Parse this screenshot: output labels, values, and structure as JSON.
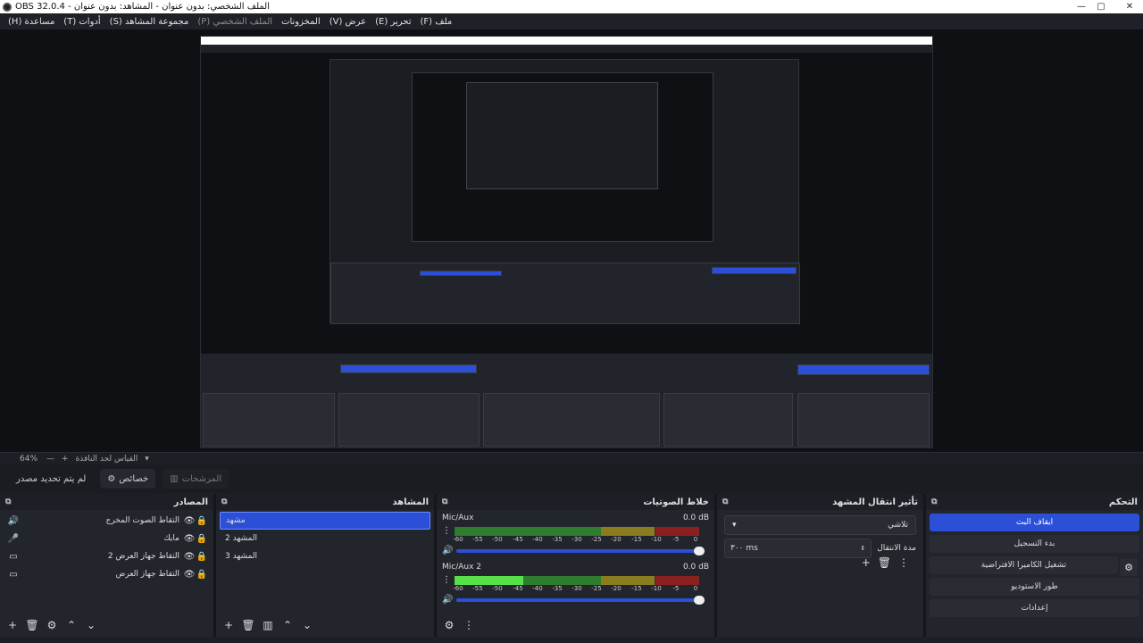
{
  "window": {
    "title": "OBS 32.0.4 - الملف الشخصي: بدون عنوان - المشاهد: بدون عنوان"
  },
  "menu": [
    {
      "label": "ملف (F)",
      "dim": false
    },
    {
      "label": "تحرير (E)",
      "dim": false
    },
    {
      "label": "عرض (V)",
      "dim": false
    },
    {
      "label": "المخزونات",
      "dim": false
    },
    {
      "label": "الملف الشخصي (P)",
      "dim": true
    },
    {
      "label": "مجموعة المشاهد (S)",
      "dim": false
    },
    {
      "label": "أدوات (T)",
      "dim": false
    },
    {
      "label": "مساعدة (H)",
      "dim": false
    }
  ],
  "preview_controls": {
    "zoom": "64%",
    "fit_label": "القياس لحد النافذة"
  },
  "source_toolbar": {
    "no_source": "لم يتم تحديد مصدر",
    "properties": "خصائص",
    "filters": "المرشحات"
  },
  "sources": {
    "title": "المصادر",
    "items": [
      {
        "name": "التقاط الصوت المخرج",
        "icon": "speaker-icon"
      },
      {
        "name": "مايك",
        "icon": "microphone-icon"
      },
      {
        "name": "التقاط جهاز العرض 2",
        "icon": "monitor-icon"
      },
      {
        "name": "التقاط جهاز العرض",
        "icon": "monitor-icon"
      }
    ]
  },
  "scenes": {
    "title": "المشاهد",
    "items": [
      {
        "name": "مشهد",
        "selected": true
      },
      {
        "name": "المشهد 2",
        "selected": false
      },
      {
        "name": "المشهد 3",
        "selected": false
      }
    ]
  },
  "mixer": {
    "title": "خلاط الصوتيات",
    "ticks": [
      "-60",
      "-55",
      "-50",
      "-45",
      "-40",
      "-35",
      "-30",
      "-25",
      "-20",
      "-15",
      "-10",
      "-5",
      "0"
    ],
    "channels": [
      {
        "name": "Mic/Aux",
        "db": "0.0 dB",
        "level": 0.0
      },
      {
        "name": "Mic/Aux 2",
        "db": "0.0 dB",
        "level": 0.28
      }
    ]
  },
  "transitions": {
    "title": "تأثير انتقال المشهد",
    "selected": "تلاشي",
    "duration_label": "مدة الانتقال",
    "duration_value": "٣٠٠ ms"
  },
  "controls": {
    "title": "التحكم",
    "buttons": [
      {
        "label": "ايقاف البث",
        "primary": true
      },
      {
        "label": "بدء التسجيل",
        "primary": false
      },
      {
        "label": "تشغيل الكاميرا الافتراضية",
        "primary": false
      },
      {
        "label": "طور الاستوديو",
        "primary": false
      },
      {
        "label": "إعدادات",
        "primary": false
      }
    ]
  },
  "colors": {
    "accent": "#2b4fd6",
    "meter_green": "#55e04a",
    "meter_yellow": "#8a7d1f",
    "meter_red": "#8a2020"
  }
}
